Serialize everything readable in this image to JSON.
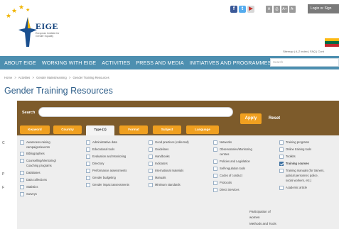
{
  "header": {
    "logo_text": "EIGE",
    "logo_subtitle": "European Institute for Gender Equality",
    "social_icons": [
      "facebook-icon",
      "twitter-icon",
      "youtube-icon"
    ],
    "tool_icons": [
      "text-size-icon",
      "print-icon",
      "font-increase-icon",
      "font-decrease-icon"
    ],
    "login_label": "Login or Sign",
    "top_links": "Sitemap | A-Z index | FAQ | Cont",
    "flag_colors": [
      "#fdb913",
      "#006a44",
      "#c1272d"
    ]
  },
  "nav": {
    "items": [
      "ABOUT EIGE",
      "WORKING WITH EIGE",
      "ACTIVITIES",
      "PRESS AND MEDIA",
      "INITIATIVES AND PROGRAMMES"
    ],
    "search_placeholder": "Search"
  },
  "breadcrumb": [
    "Home",
    ">",
    "Activities",
    ">",
    "Gender Mainstreaming",
    ">",
    "Gender Training Resources"
  ],
  "page_title": "Gender Training Resources",
  "filter": {
    "search_label": "Search",
    "apply_label": "Apply",
    "reset_label": "Reset",
    "tabs": [
      {
        "label": "Keyword",
        "active": false
      },
      {
        "label": "Country",
        "active": false
      },
      {
        "label": "Type (1)",
        "active": true
      },
      {
        "label": "Format",
        "active": false
      },
      {
        "label": "Subject",
        "active": false
      },
      {
        "label": "Language",
        "active": false
      }
    ],
    "columns": [
      {
        "items": [
          {
            "label": "Awareness-raising",
            "checked": false
          },
          {
            "label": "campaigns/events",
            "checked": null
          },
          {
            "label": "Bibliographies",
            "checked": false
          },
          {
            "label": "Counselling/Mentoring/",
            "checked": false
          },
          {
            "label": "Coaching programs",
            "checked": null
          },
          {
            "label": "Databases",
            "checked": false
          },
          {
            "label": "Data collections",
            "checked": false
          },
          {
            "label": "Statistics",
            "checked": false
          },
          {
            "label": "Surveys",
            "checked": false
          }
        ]
      },
      {
        "items": [
          {
            "label": "Administrative data",
            "checked": false
          },
          {
            "label": "Educational tools",
            "checked": false
          },
          {
            "label": "Evaluation and Monitoring",
            "checked": false
          },
          {
            "label": "Directory",
            "checked": false
          },
          {
            "label": "Performance assessments",
            "checked": false
          },
          {
            "label": "Gender budgeting",
            "checked": false
          },
          {
            "label": "Gender impact assessments",
            "checked": false
          }
        ]
      },
      {
        "items": [
          {
            "label": "Good practices (collected)",
            "checked": false
          },
          {
            "label": "Guidelines",
            "checked": false
          },
          {
            "label": "Handbooks",
            "checked": false
          },
          {
            "label": "Indicators",
            "checked": false
          },
          {
            "label": "International materials",
            "checked": false
          },
          {
            "label": "Manuals",
            "checked": false
          },
          {
            "label": "Minimum standards",
            "checked": false
          }
        ]
      },
      {
        "items": [
          {
            "label": "Networks",
            "checked": false
          },
          {
            "label": "Observatories/Monitoring",
            "checked": false
          },
          {
            "label": "centres",
            "checked": null
          },
          {
            "label": "Policies and Legislation",
            "checked": false
          },
          {
            "label": "Self-regulation tools",
            "checked": false
          },
          {
            "label": "Codes of conduct",
            "checked": false
          },
          {
            "label": "Protocols",
            "checked": false
          },
          {
            "label": "Direct Services",
            "checked": false
          }
        ]
      },
      {
        "items": [
          {
            "label": "Training programs",
            "checked": false
          },
          {
            "label": "Online training tools",
            "checked": false
          },
          {
            "label": "Toolkits",
            "checked": false
          },
          {
            "label": "Training courses",
            "checked": true
          },
          {
            "label": "Training manuals (for trainers,",
            "checked": false
          },
          {
            "label": "judicial personnel, police,",
            "checked": null
          },
          {
            "label": "social workers, etc.)",
            "checked": null
          },
          {
            "label": "Academic article",
            "checked": false
          }
        ]
      }
    ]
  },
  "side_letters": [
    "C",
    "P",
    "F"
  ],
  "bottom_text": [
    "Participation of",
    "women",
    "Methods and Tools"
  ]
}
